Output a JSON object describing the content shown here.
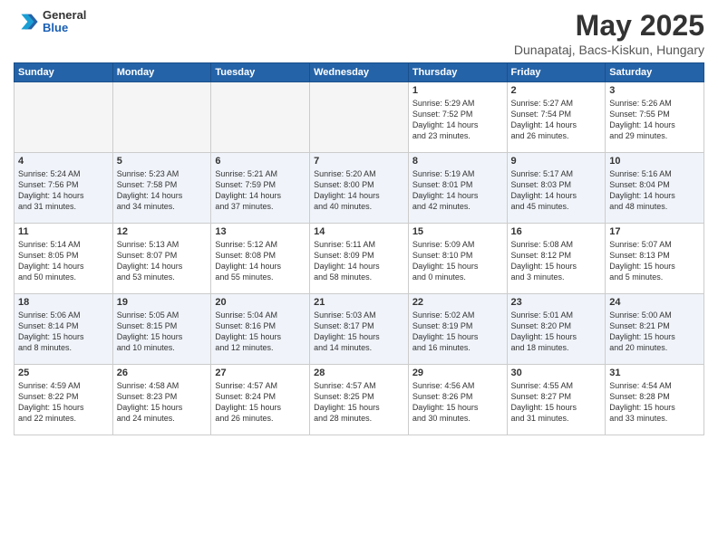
{
  "header": {
    "logo": {
      "general": "General",
      "blue": "Blue"
    },
    "title": "May 2025",
    "location": "Dunapataj, Bacs-Kiskun, Hungary"
  },
  "weekdays": [
    "Sunday",
    "Monday",
    "Tuesday",
    "Wednesday",
    "Thursday",
    "Friday",
    "Saturday"
  ],
  "weeks": [
    [
      {
        "day": "",
        "info": ""
      },
      {
        "day": "",
        "info": ""
      },
      {
        "day": "",
        "info": ""
      },
      {
        "day": "",
        "info": ""
      },
      {
        "day": "1",
        "info": "Sunrise: 5:29 AM\nSunset: 7:52 PM\nDaylight: 14 hours\nand 23 minutes."
      },
      {
        "day": "2",
        "info": "Sunrise: 5:27 AM\nSunset: 7:54 PM\nDaylight: 14 hours\nand 26 minutes."
      },
      {
        "day": "3",
        "info": "Sunrise: 5:26 AM\nSunset: 7:55 PM\nDaylight: 14 hours\nand 29 minutes."
      }
    ],
    [
      {
        "day": "4",
        "info": "Sunrise: 5:24 AM\nSunset: 7:56 PM\nDaylight: 14 hours\nand 31 minutes."
      },
      {
        "day": "5",
        "info": "Sunrise: 5:23 AM\nSunset: 7:58 PM\nDaylight: 14 hours\nand 34 minutes."
      },
      {
        "day": "6",
        "info": "Sunrise: 5:21 AM\nSunset: 7:59 PM\nDaylight: 14 hours\nand 37 minutes."
      },
      {
        "day": "7",
        "info": "Sunrise: 5:20 AM\nSunset: 8:00 PM\nDaylight: 14 hours\nand 40 minutes."
      },
      {
        "day": "8",
        "info": "Sunrise: 5:19 AM\nSunset: 8:01 PM\nDaylight: 14 hours\nand 42 minutes."
      },
      {
        "day": "9",
        "info": "Sunrise: 5:17 AM\nSunset: 8:03 PM\nDaylight: 14 hours\nand 45 minutes."
      },
      {
        "day": "10",
        "info": "Sunrise: 5:16 AM\nSunset: 8:04 PM\nDaylight: 14 hours\nand 48 minutes."
      }
    ],
    [
      {
        "day": "11",
        "info": "Sunrise: 5:14 AM\nSunset: 8:05 PM\nDaylight: 14 hours\nand 50 minutes."
      },
      {
        "day": "12",
        "info": "Sunrise: 5:13 AM\nSunset: 8:07 PM\nDaylight: 14 hours\nand 53 minutes."
      },
      {
        "day": "13",
        "info": "Sunrise: 5:12 AM\nSunset: 8:08 PM\nDaylight: 14 hours\nand 55 minutes."
      },
      {
        "day": "14",
        "info": "Sunrise: 5:11 AM\nSunset: 8:09 PM\nDaylight: 14 hours\nand 58 minutes."
      },
      {
        "day": "15",
        "info": "Sunrise: 5:09 AM\nSunset: 8:10 PM\nDaylight: 15 hours\nand 0 minutes."
      },
      {
        "day": "16",
        "info": "Sunrise: 5:08 AM\nSunset: 8:12 PM\nDaylight: 15 hours\nand 3 minutes."
      },
      {
        "day": "17",
        "info": "Sunrise: 5:07 AM\nSunset: 8:13 PM\nDaylight: 15 hours\nand 5 minutes."
      }
    ],
    [
      {
        "day": "18",
        "info": "Sunrise: 5:06 AM\nSunset: 8:14 PM\nDaylight: 15 hours\nand 8 minutes."
      },
      {
        "day": "19",
        "info": "Sunrise: 5:05 AM\nSunset: 8:15 PM\nDaylight: 15 hours\nand 10 minutes."
      },
      {
        "day": "20",
        "info": "Sunrise: 5:04 AM\nSunset: 8:16 PM\nDaylight: 15 hours\nand 12 minutes."
      },
      {
        "day": "21",
        "info": "Sunrise: 5:03 AM\nSunset: 8:17 PM\nDaylight: 15 hours\nand 14 minutes."
      },
      {
        "day": "22",
        "info": "Sunrise: 5:02 AM\nSunset: 8:19 PM\nDaylight: 15 hours\nand 16 minutes."
      },
      {
        "day": "23",
        "info": "Sunrise: 5:01 AM\nSunset: 8:20 PM\nDaylight: 15 hours\nand 18 minutes."
      },
      {
        "day": "24",
        "info": "Sunrise: 5:00 AM\nSunset: 8:21 PM\nDaylight: 15 hours\nand 20 minutes."
      }
    ],
    [
      {
        "day": "25",
        "info": "Sunrise: 4:59 AM\nSunset: 8:22 PM\nDaylight: 15 hours\nand 22 minutes."
      },
      {
        "day": "26",
        "info": "Sunrise: 4:58 AM\nSunset: 8:23 PM\nDaylight: 15 hours\nand 24 minutes."
      },
      {
        "day": "27",
        "info": "Sunrise: 4:57 AM\nSunset: 8:24 PM\nDaylight: 15 hours\nand 26 minutes."
      },
      {
        "day": "28",
        "info": "Sunrise: 4:57 AM\nSunset: 8:25 PM\nDaylight: 15 hours\nand 28 minutes."
      },
      {
        "day": "29",
        "info": "Sunrise: 4:56 AM\nSunset: 8:26 PM\nDaylight: 15 hours\nand 30 minutes."
      },
      {
        "day": "30",
        "info": "Sunrise: 4:55 AM\nSunset: 8:27 PM\nDaylight: 15 hours\nand 31 minutes."
      },
      {
        "day": "31",
        "info": "Sunrise: 4:54 AM\nSunset: 8:28 PM\nDaylight: 15 hours\nand 33 minutes."
      }
    ]
  ]
}
